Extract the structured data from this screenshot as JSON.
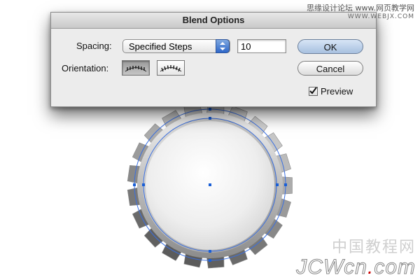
{
  "watermark_top": {
    "line1": "思缘设计论坛  www.网页教学网",
    "line2": "WWW.WEBJX.COM"
  },
  "dialog": {
    "title": "Blend Options",
    "spacing_label": "Spacing:",
    "spacing_value": "Specified Steps",
    "steps_value": "10",
    "orientation_label": "Orientation:",
    "orientation_options": [
      "align-to-page",
      "align-to-path"
    ],
    "orientation_selected": "align-to-page",
    "ok_label": "OK",
    "cancel_label": "Cancel",
    "preview_label": "Preview",
    "preview_checked": true
  },
  "watermark_bottom": {
    "chinese": "中国教程网",
    "latin_before_dot": "JCWcn",
    "dot": ".",
    "latin_after_dot": "com"
  },
  "colors": {
    "path_blue": "#3a6fe0",
    "anchor_blue": "#1a5fd6",
    "dialog_bg": "#ececec",
    "watermark_dot": "#cc0000"
  }
}
